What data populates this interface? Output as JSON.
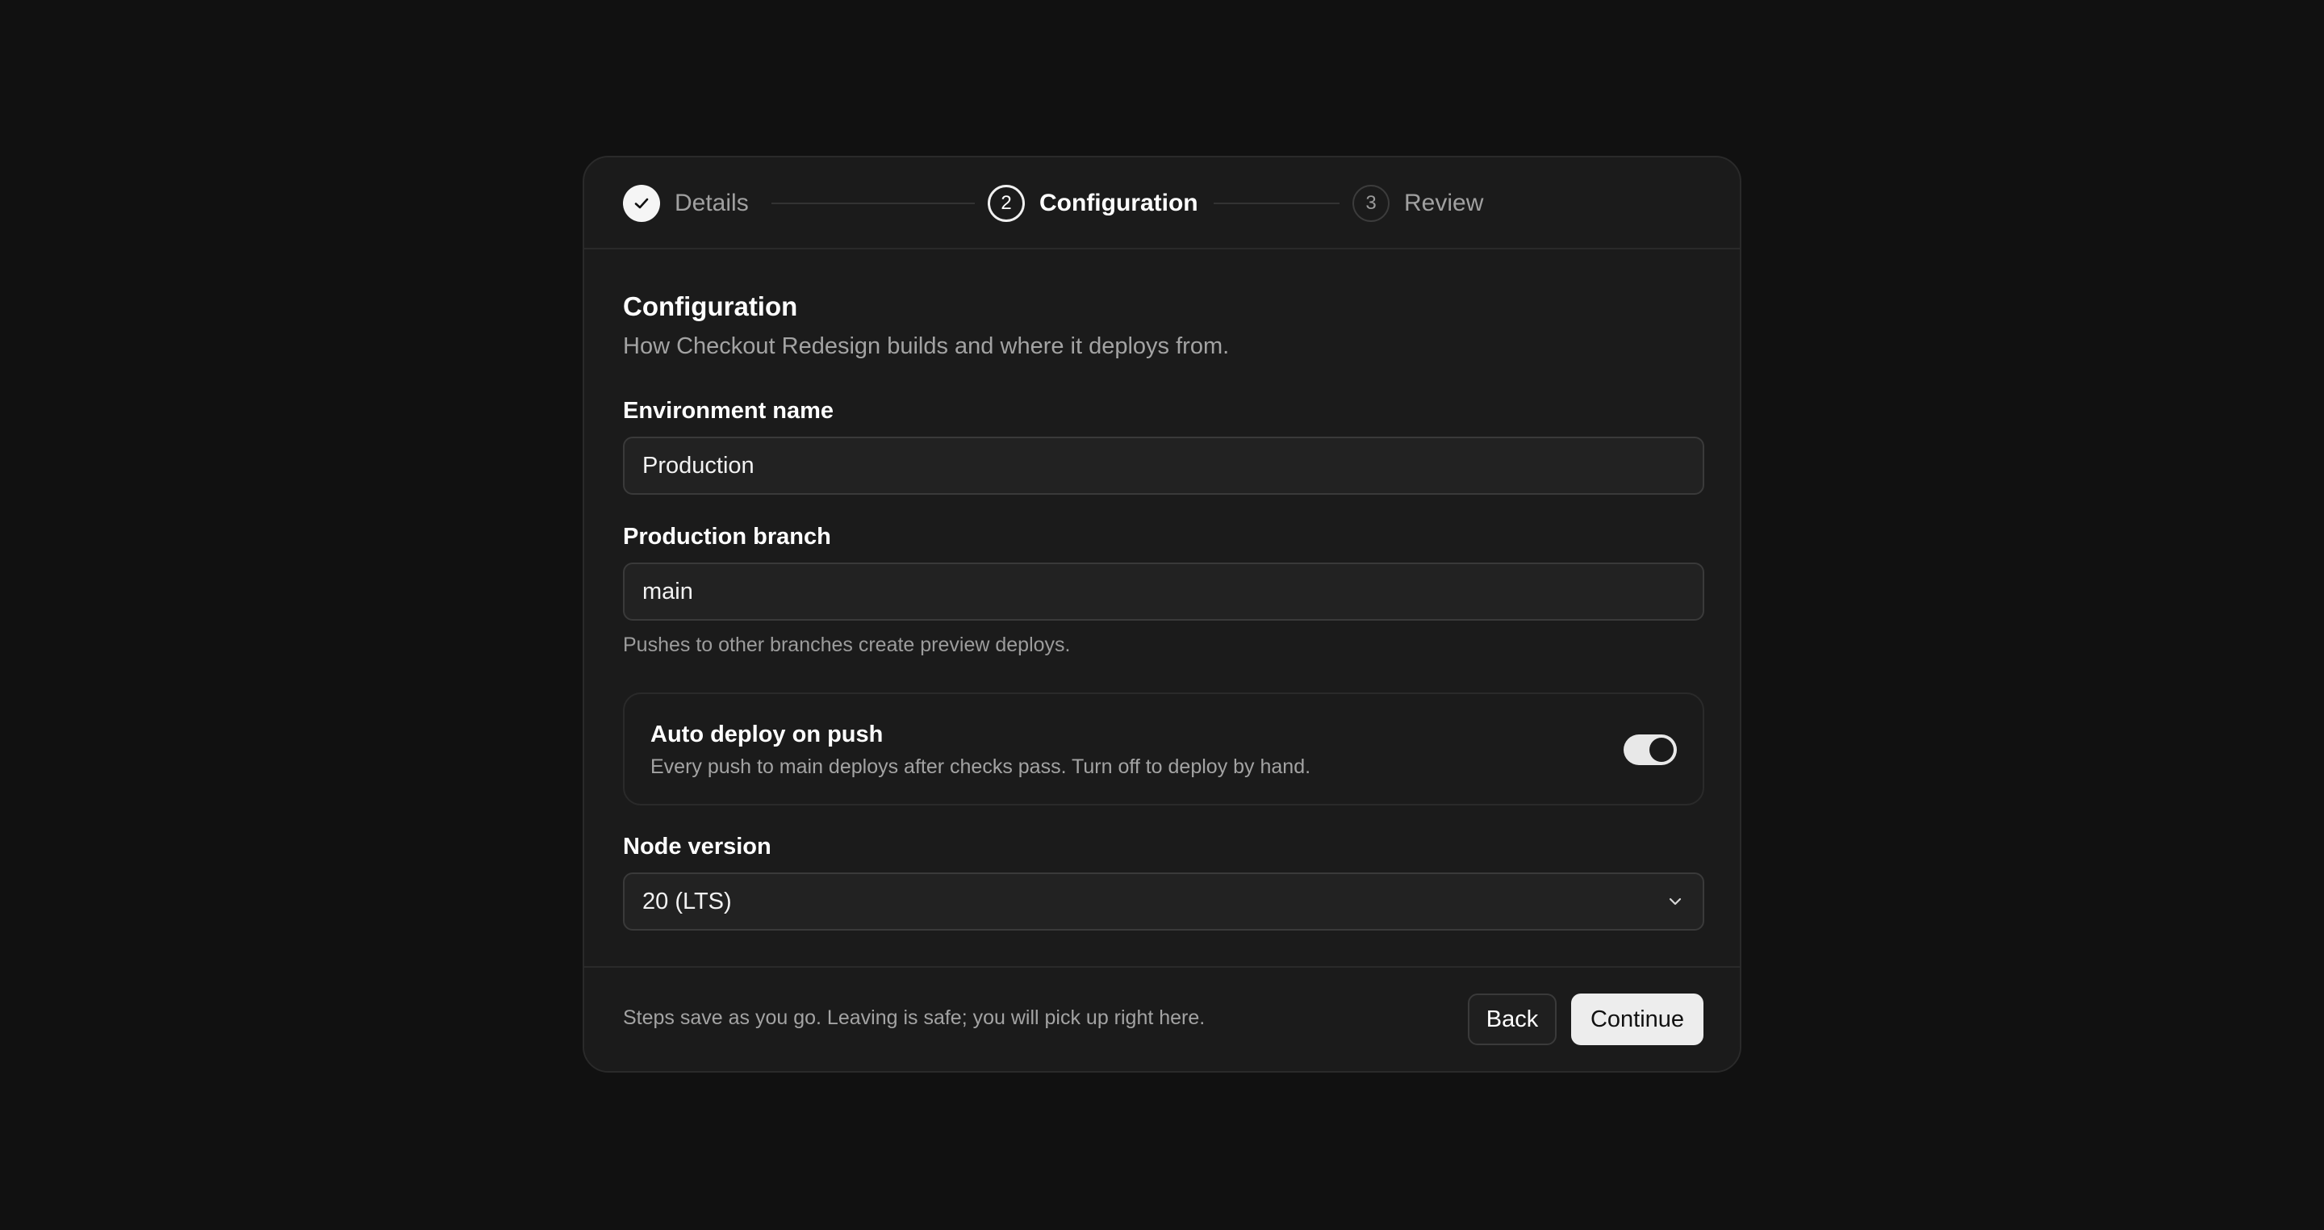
{
  "stepper": {
    "steps": [
      {
        "number": "",
        "label": "Details",
        "state": "complete"
      },
      {
        "number": "2",
        "label": "Configuration",
        "state": "active"
      },
      {
        "number": "3",
        "label": "Review",
        "state": "upcoming"
      }
    ]
  },
  "section": {
    "title": "Configuration",
    "subtitle": "How Checkout Redesign builds and where it deploys from."
  },
  "fields": {
    "environment_name": {
      "label": "Environment name",
      "value": "Production"
    },
    "production_branch": {
      "label": "Production branch",
      "value": "main",
      "hint": "Pushes to other branches create preview deploys."
    },
    "auto_deploy": {
      "title": "Auto deploy on push",
      "description": "Every push to main deploys after checks pass. Turn off to deploy by hand.",
      "enabled": true
    },
    "node_version": {
      "label": "Node version",
      "value": "20 (LTS)"
    }
  },
  "footer": {
    "note": "Steps save as you go. Leaving is safe; you will pick up right here.",
    "back_label": "Back",
    "continue_label": "Continue"
  },
  "icons": {
    "step_complete": "check-icon",
    "select": "chevron-down-icon"
  },
  "colors": {
    "background": "#111111",
    "card": "#1b1b1b",
    "primary_button": "#ededed"
  }
}
